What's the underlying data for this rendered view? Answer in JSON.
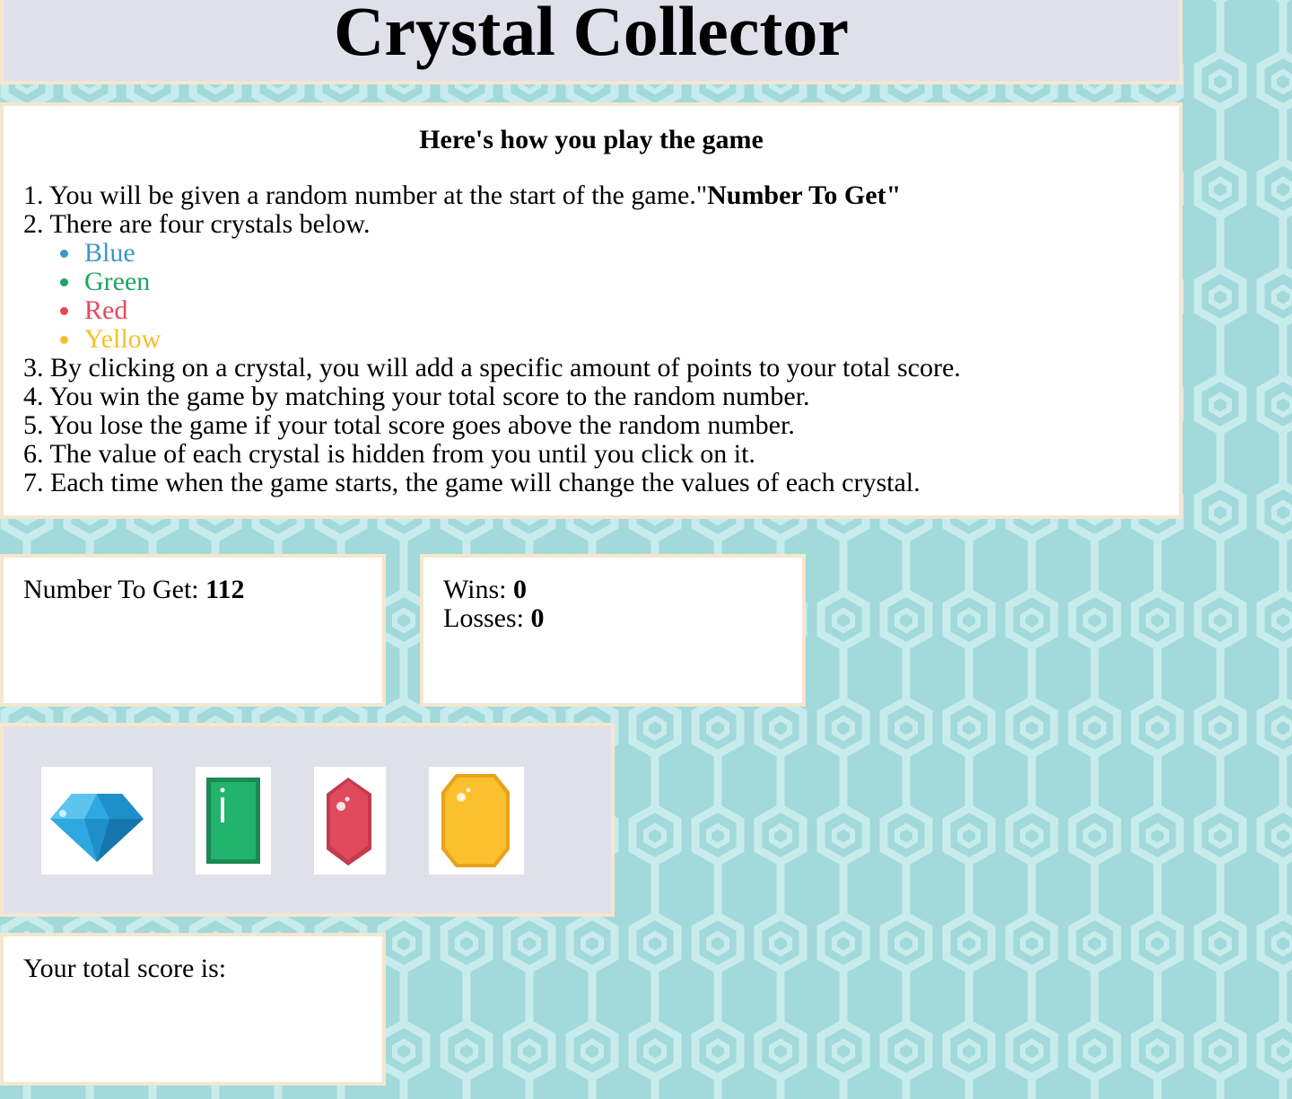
{
  "title": "Crystal Collector",
  "instructions": {
    "heading": "Here's how you play the game",
    "step1_num": "1.",
    "step1_text": "You will be given a random number at the start of the game.\"",
    "step1_bold": "Number To Get",
    "step1_end": "\"",
    "step2_num": "2.",
    "step2_text": "There are four crystals below.",
    "colors": [
      {
        "label": "Blue",
        "color": "#3a97c9"
      },
      {
        "label": "Green",
        "color": "#1aa760"
      },
      {
        "label": "Red",
        "color": "#e04a5c"
      },
      {
        "label": "Yellow",
        "color": "#f5c02c"
      }
    ],
    "steps": [
      {
        "num": "3.",
        "text": "By clicking on a crystal, you will add a specific amount of points to your total score."
      },
      {
        "num": "4.",
        "text": "You win the game by matching your total score to the random number."
      },
      {
        "num": "5.",
        "text": "You lose the game if your total score goes above the random number."
      },
      {
        "num": "6.",
        "text": "The value of each crystal is hidden from you until you click on it."
      },
      {
        "num": "7.",
        "text": "Each time when the game starts, the game will change the values of each crystal."
      }
    ]
  },
  "target": {
    "label": "Number To Get: ",
    "value": "112"
  },
  "record": {
    "wins_label": "Wins: ",
    "wins": "0",
    "losses_label": "Losses: ",
    "losses": "0"
  },
  "score": {
    "label": "Your total score is:"
  },
  "crystals": [
    {
      "icon": "blue-diamond-icon"
    },
    {
      "icon": "green-emerald-icon"
    },
    {
      "icon": "red-ruby-icon"
    },
    {
      "icon": "yellow-topaz-icon"
    }
  ],
  "theme": {
    "background": "#a2d9da",
    "panel_gray": "#e0e0ea",
    "panel_border": "#f5e6cf"
  }
}
